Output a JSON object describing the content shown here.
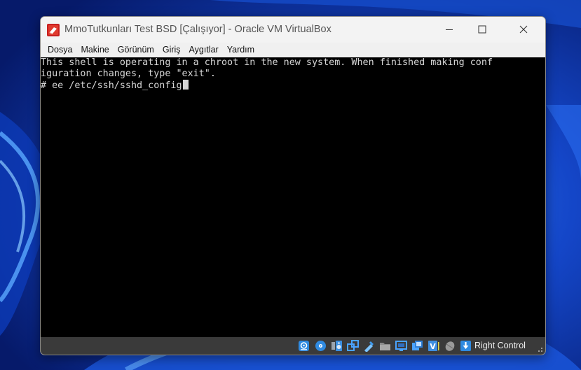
{
  "window": {
    "title": "MmoTutkunları Test BSD [Çalışıyor] - Oracle VM VirtualBox",
    "app_icon": "virtualbox-icon"
  },
  "title_controls": [
    "minimize-icon",
    "maximize-icon",
    "close-icon"
  ],
  "menu": {
    "items": [
      {
        "label": "Dosya"
      },
      {
        "label": "Makine"
      },
      {
        "label": "Görünüm"
      },
      {
        "label": "Giriş"
      },
      {
        "label": "Aygıtlar"
      },
      {
        "label": "Yardım"
      }
    ]
  },
  "console": {
    "lines": [
      "This shell is operating in a chroot in the new system. When finished making conf",
      "iguration changes, type \"exit\".",
      "# ee /etc/ssh/sshd_config"
    ]
  },
  "status": {
    "icons": [
      "hard-disk-icon",
      "optical-drive-icon",
      "audio-icon",
      "network-icon",
      "usb-icon",
      "shared-folders-icon",
      "display-icon",
      "recording-icon",
      "virtualization-icon",
      "mouse-integration-icon",
      "keyboard-icon"
    ],
    "host_key": "Right Control"
  },
  "colors": {
    "console_bg": "#000000",
    "console_fg": "#d6d6d6",
    "statusbar_bg": "#3a3a3a",
    "accent": "#1f7fd6"
  }
}
